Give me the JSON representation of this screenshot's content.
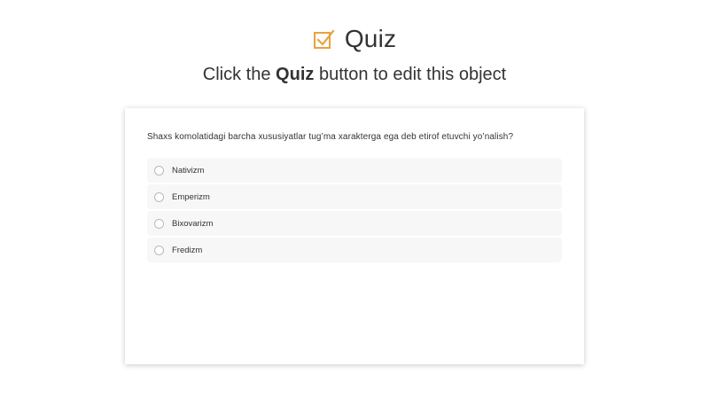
{
  "header": {
    "title": "Quiz",
    "icon": "checkbox-check-icon",
    "accent_color": "#e8a33d"
  },
  "subtitle": {
    "prefix": "Click the ",
    "emphasis": "Quiz",
    "suffix": " button to edit this object"
  },
  "quiz": {
    "question": "Shaxs komolatidagi barcha xususiyatlar tug’ma xarakterga ega deb etirof etuvchi yo’nalish?",
    "options": [
      {
        "label": "Nativizm"
      },
      {
        "label": "Emperizm"
      },
      {
        "label": "Bixovarizm"
      },
      {
        "label": "Fredizm"
      }
    ]
  }
}
